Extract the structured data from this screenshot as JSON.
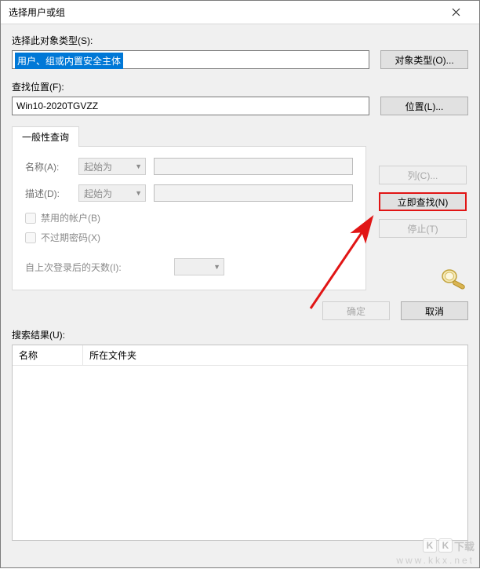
{
  "title": "选择用户或组",
  "sections": {
    "object_type_label": "选择此对象类型(S):",
    "object_type_value": "用户、组或内置安全主体",
    "object_type_button": "对象类型(O)...",
    "location_label": "查找位置(F):",
    "location_value": "Win10-2020TGVZZ",
    "location_button": "位置(L)..."
  },
  "tab": {
    "label": "一般性查询",
    "name_label": "名称(A):",
    "name_combo": "起始为",
    "desc_label": "描述(D):",
    "desc_combo": "起始为",
    "check_disabled": "禁用的帐户(B)",
    "check_password": "不过期密码(X)",
    "days_label": "自上次登录后的天数(I):"
  },
  "rightButtons": {
    "columns": "列(C)...",
    "find_now": "立即查找(N)",
    "stop": "停止(T)"
  },
  "bottom": {
    "ok": "确定",
    "cancel": "取消"
  },
  "results": {
    "label": "搜索结果(U):",
    "col_name": "名称",
    "col_folder": "所在文件夹"
  },
  "watermark": {
    "brand": "下载",
    "url": "www.kkx.net"
  }
}
